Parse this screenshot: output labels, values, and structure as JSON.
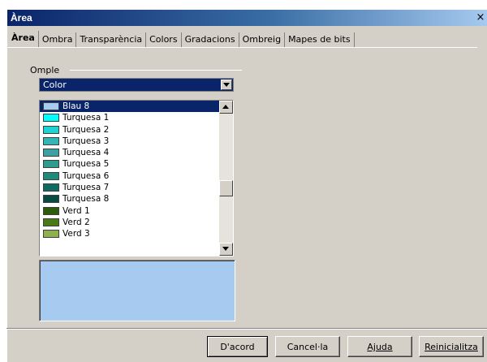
{
  "dialog": {
    "title": "Àrea",
    "close_glyph": "×"
  },
  "tabs": [
    {
      "label": "Àrea",
      "active": true
    },
    {
      "label": "Ombra"
    },
    {
      "label": "Transparència"
    },
    {
      "label": "Colors"
    },
    {
      "label": "Gradacions"
    },
    {
      "label": "Ombreig"
    },
    {
      "label": "Mapes de bits"
    }
  ],
  "fill": {
    "group_label": "Omple",
    "selected_value": "Color"
  },
  "color_list": {
    "items": [
      {
        "label": "Blau 8",
        "color": "#a6caf0",
        "selected": true
      },
      {
        "label": "Turquesa 1",
        "color": "#00ffff"
      },
      {
        "label": "Turquesa 2",
        "color": "#1fd1d1"
      },
      {
        "label": "Turquesa 3",
        "color": "#33b5b5"
      },
      {
        "label": "Turquesa 4",
        "color": "#3ea0a0"
      },
      {
        "label": "Turquesa 5",
        "color": "#2f9a8e"
      },
      {
        "label": "Turquesa 6",
        "color": "#1e8a7a"
      },
      {
        "label": "Turquesa 7",
        "color": "#0e6b62"
      },
      {
        "label": "Turquesa 8",
        "color": "#064a44"
      },
      {
        "label": "Verd 1",
        "color": "#2e5a0e"
      },
      {
        "label": "Verd 2",
        "color": "#4a7a18"
      },
      {
        "label": "Verd 3",
        "color": "#8fb050"
      }
    ]
  },
  "preview": {
    "color": "#a6caf0"
  },
  "buttons": {
    "ok": "D'acord",
    "cancel": "Cancel·la",
    "help": "Ajuda",
    "reset": "Reinicialitza"
  }
}
